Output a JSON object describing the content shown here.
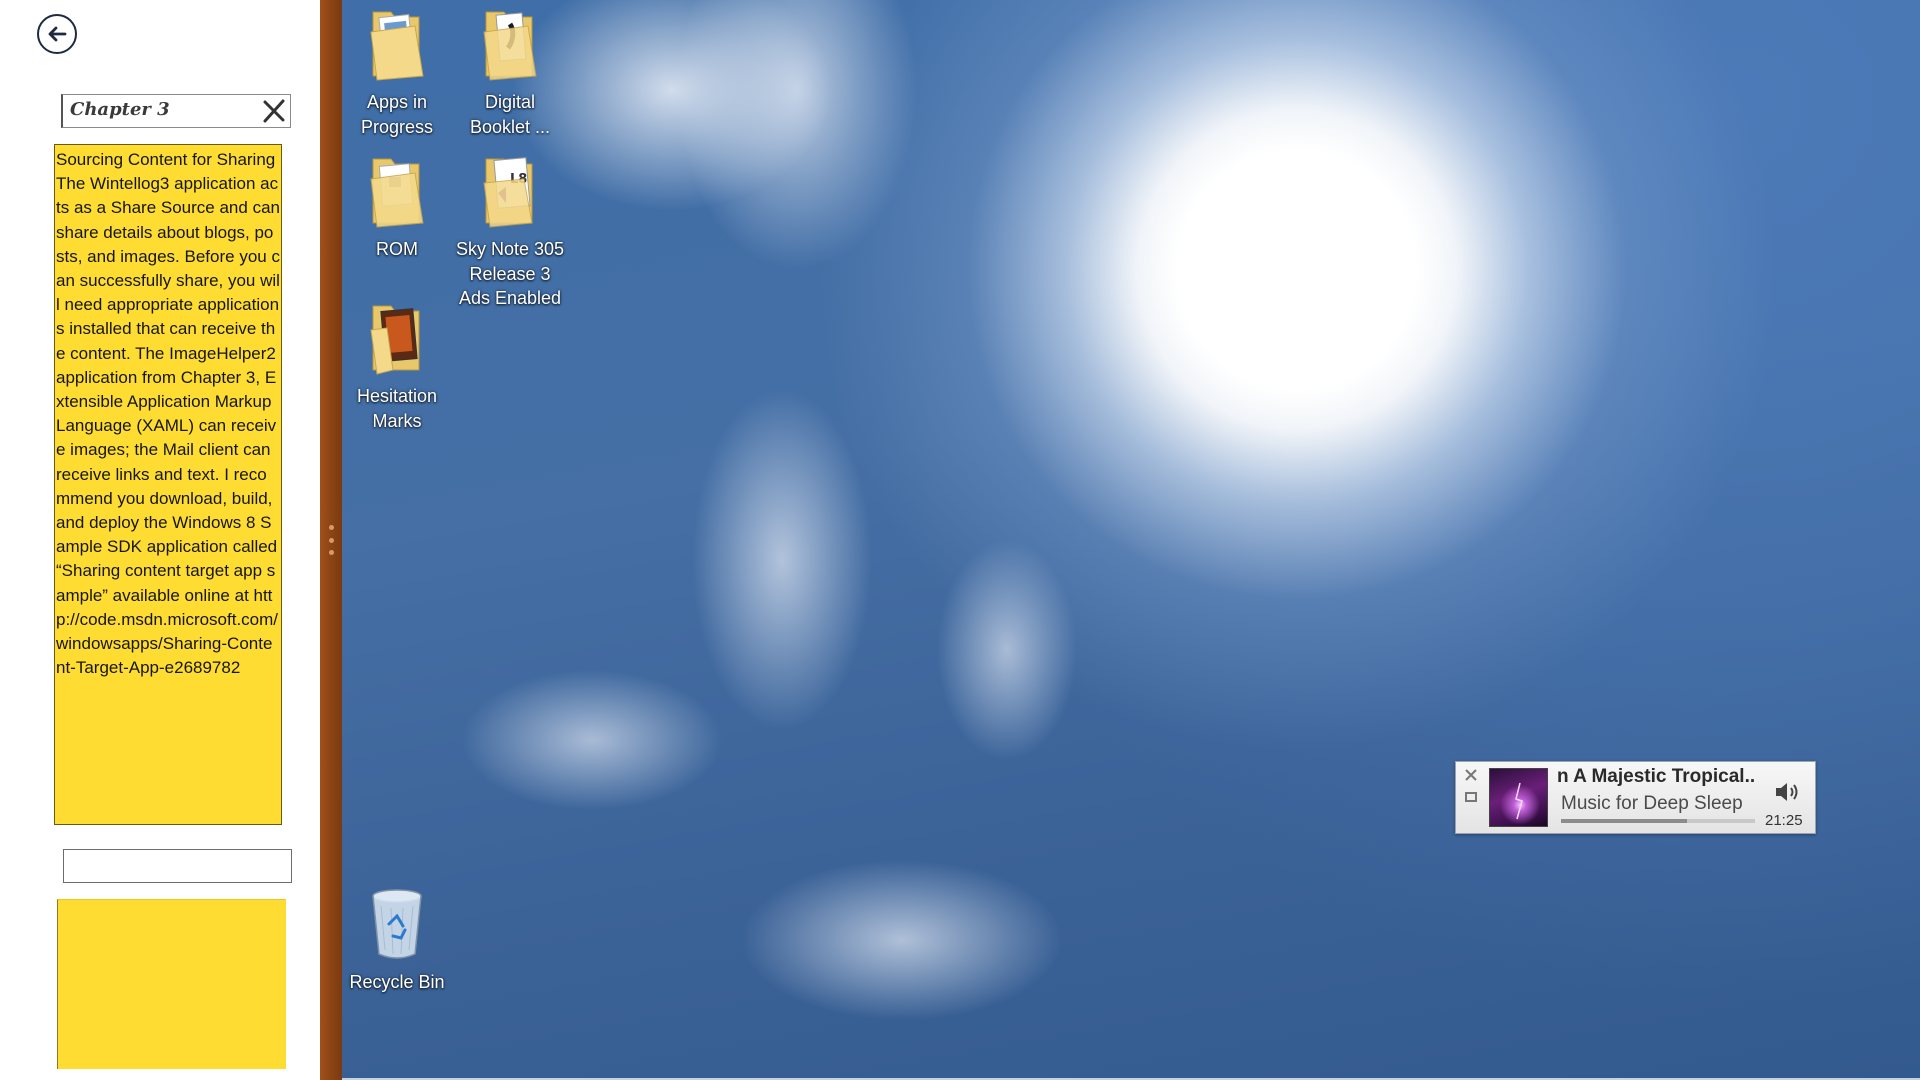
{
  "snap_app": {
    "search_value": "Chapter 3",
    "content": {
      "title": "Sourcing Content for Sharing",
      "body": "The Wintellog3 application acts as a Share Source and can share details about blogs, posts, and images. Before you can successfully share, you will need appropriate applications installed that can receive the content. The ImageHelper2 application from Chapter 3, Extensible Application Markup Language (XAML) can receive images; the Mail client can receive links and text. I recommend you download, build, and deploy the Windows 8 Sample SDK application called “Sharing content target app sample” available online at http://code.msdn.microsoft.com/windowsapps/Sharing-Content-Target-App-e2689782"
    },
    "note_input_value": "",
    "card_color": "#fedc32"
  },
  "desktop": {
    "icons": [
      {
        "label": "Apps in Progress",
        "icon": "folder-icon"
      },
      {
        "label": "Digital Booklet ...",
        "icon": "folder-icon"
      },
      {
        "label": "ROM",
        "icon": "folder-icon"
      },
      {
        "label": "Sky Note 305 Release 3 Ads Enabled",
        "icon": "folder-icon"
      },
      {
        "label": "Hesitation Marks",
        "icon": "folder-icon"
      },
      {
        "label": "Recycle Bin",
        "icon": "recycle-bin-icon"
      }
    ]
  },
  "media_player": {
    "title": "n   A Majestic Tropical..",
    "subtitle": "Music for Deep Sleep",
    "time": "21:25",
    "progress": 0.65
  },
  "colors": {
    "divider": "#8c4414",
    "card": "#fedc32"
  }
}
